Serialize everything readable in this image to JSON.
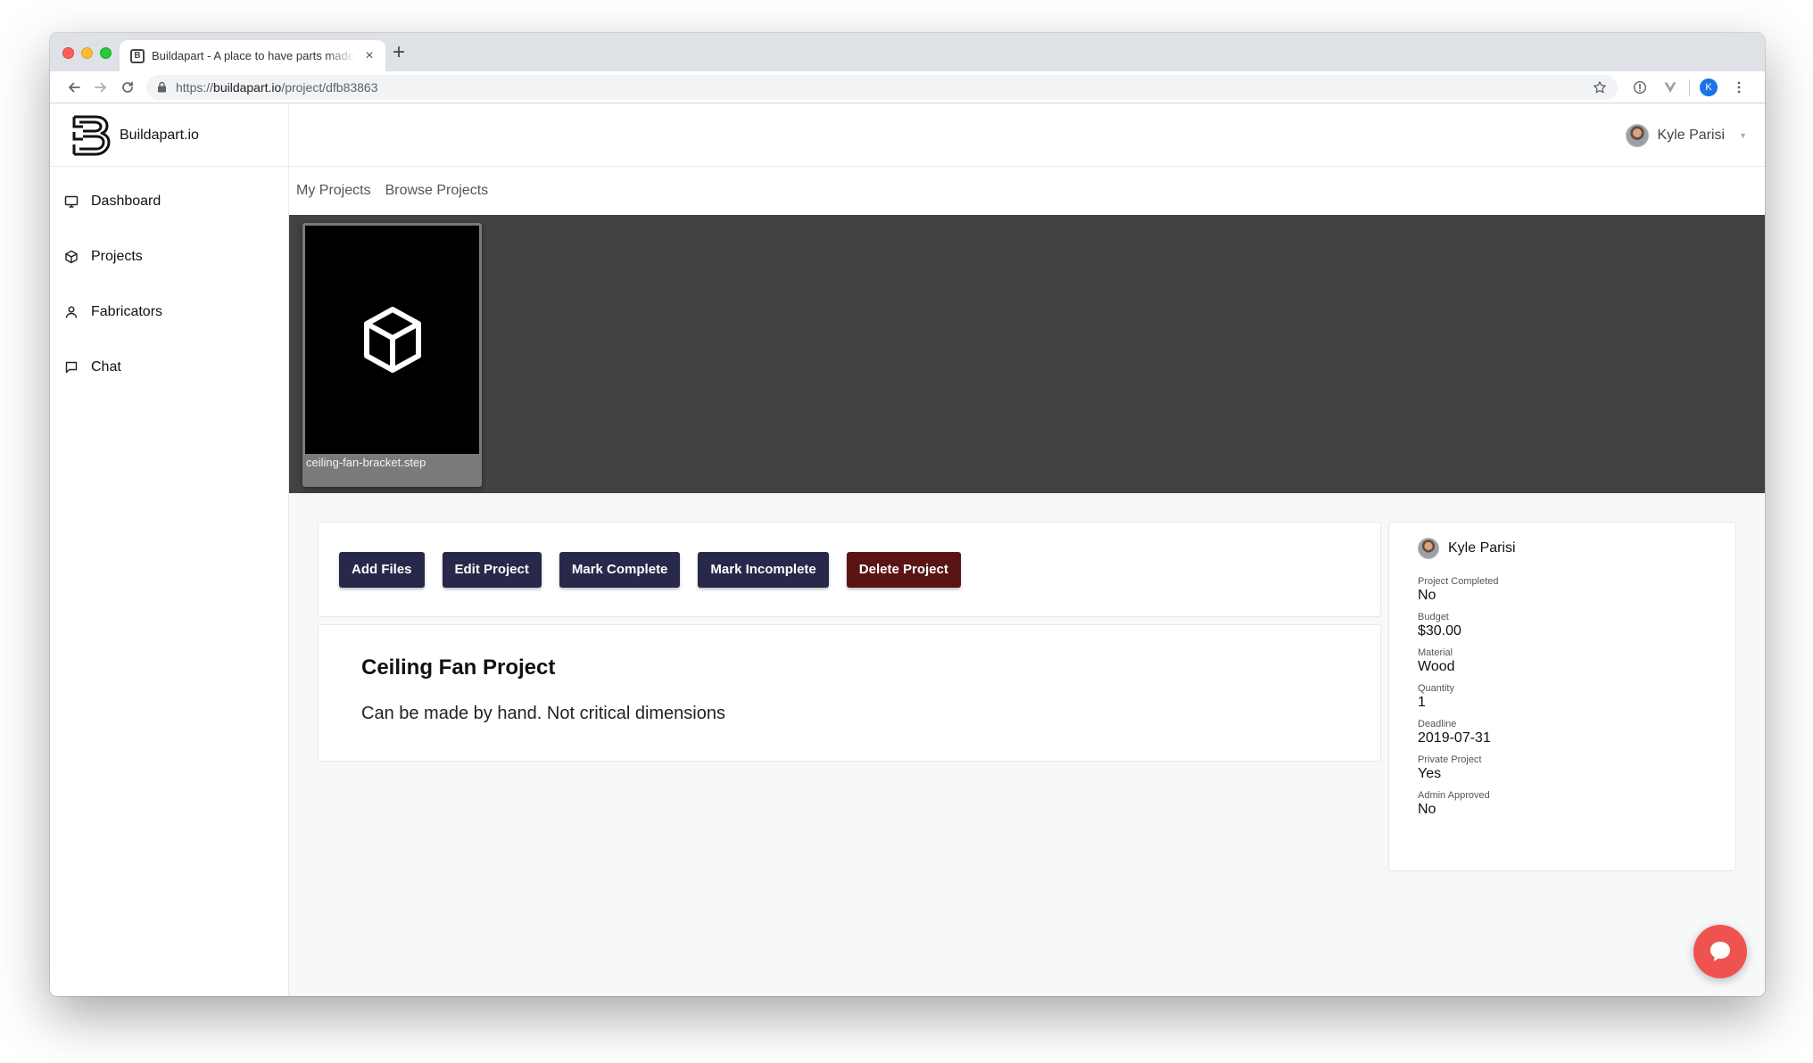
{
  "browser": {
    "tab_title": "Buildapart - A place to have parts made",
    "tab_favicon": "B",
    "tab_close": "×",
    "new_tab": "+",
    "url_scheme": "https://",
    "url_host": "buildapart.io",
    "url_path": "/project/dfb83863",
    "profile_initial": "K"
  },
  "app": {
    "brand_name": "Buildapart.io",
    "user_name": "Kyle Parisi",
    "sidebar": {
      "items": [
        {
          "label": "Dashboard",
          "icon": "monitor-icon"
        },
        {
          "label": "Projects",
          "icon": "cube-icon"
        },
        {
          "label": "Fabricators",
          "icon": "user-icon"
        },
        {
          "label": "Chat",
          "icon": "message-icon"
        }
      ]
    },
    "subnav": {
      "my_projects": "My Projects",
      "browse_projects": "Browse Projects"
    },
    "files": [
      {
        "name": "ceiling-fan-bracket.step",
        "icon": "cube-icon"
      }
    ],
    "actions": {
      "add_files": "Add Files",
      "edit_project": "Edit Project",
      "mark_complete": "Mark Complete",
      "mark_incomplete": "Mark Incomplete",
      "delete_project": "Delete Project"
    },
    "project": {
      "title": "Ceiling Fan Project",
      "description": "Can be made by hand. Not critical dimensions"
    },
    "info": {
      "owner": "Kyle Parisi",
      "fields": [
        {
          "label": "Project Completed",
          "value": "No"
        },
        {
          "label": "Budget",
          "value": "$30.00"
        },
        {
          "label": "Material",
          "value": "Wood"
        },
        {
          "label": "Quantity",
          "value": "1"
        },
        {
          "label": "Deadline",
          "value": "2019-07-31"
        },
        {
          "label": "Private Project",
          "value": "Yes"
        },
        {
          "label": "Admin Approved",
          "value": "No"
        }
      ]
    },
    "colors": {
      "button_primary": "#28284a",
      "button_danger": "#5a1414",
      "viewer_bg": "#424242",
      "chat_bubble": "#ef5350"
    }
  }
}
